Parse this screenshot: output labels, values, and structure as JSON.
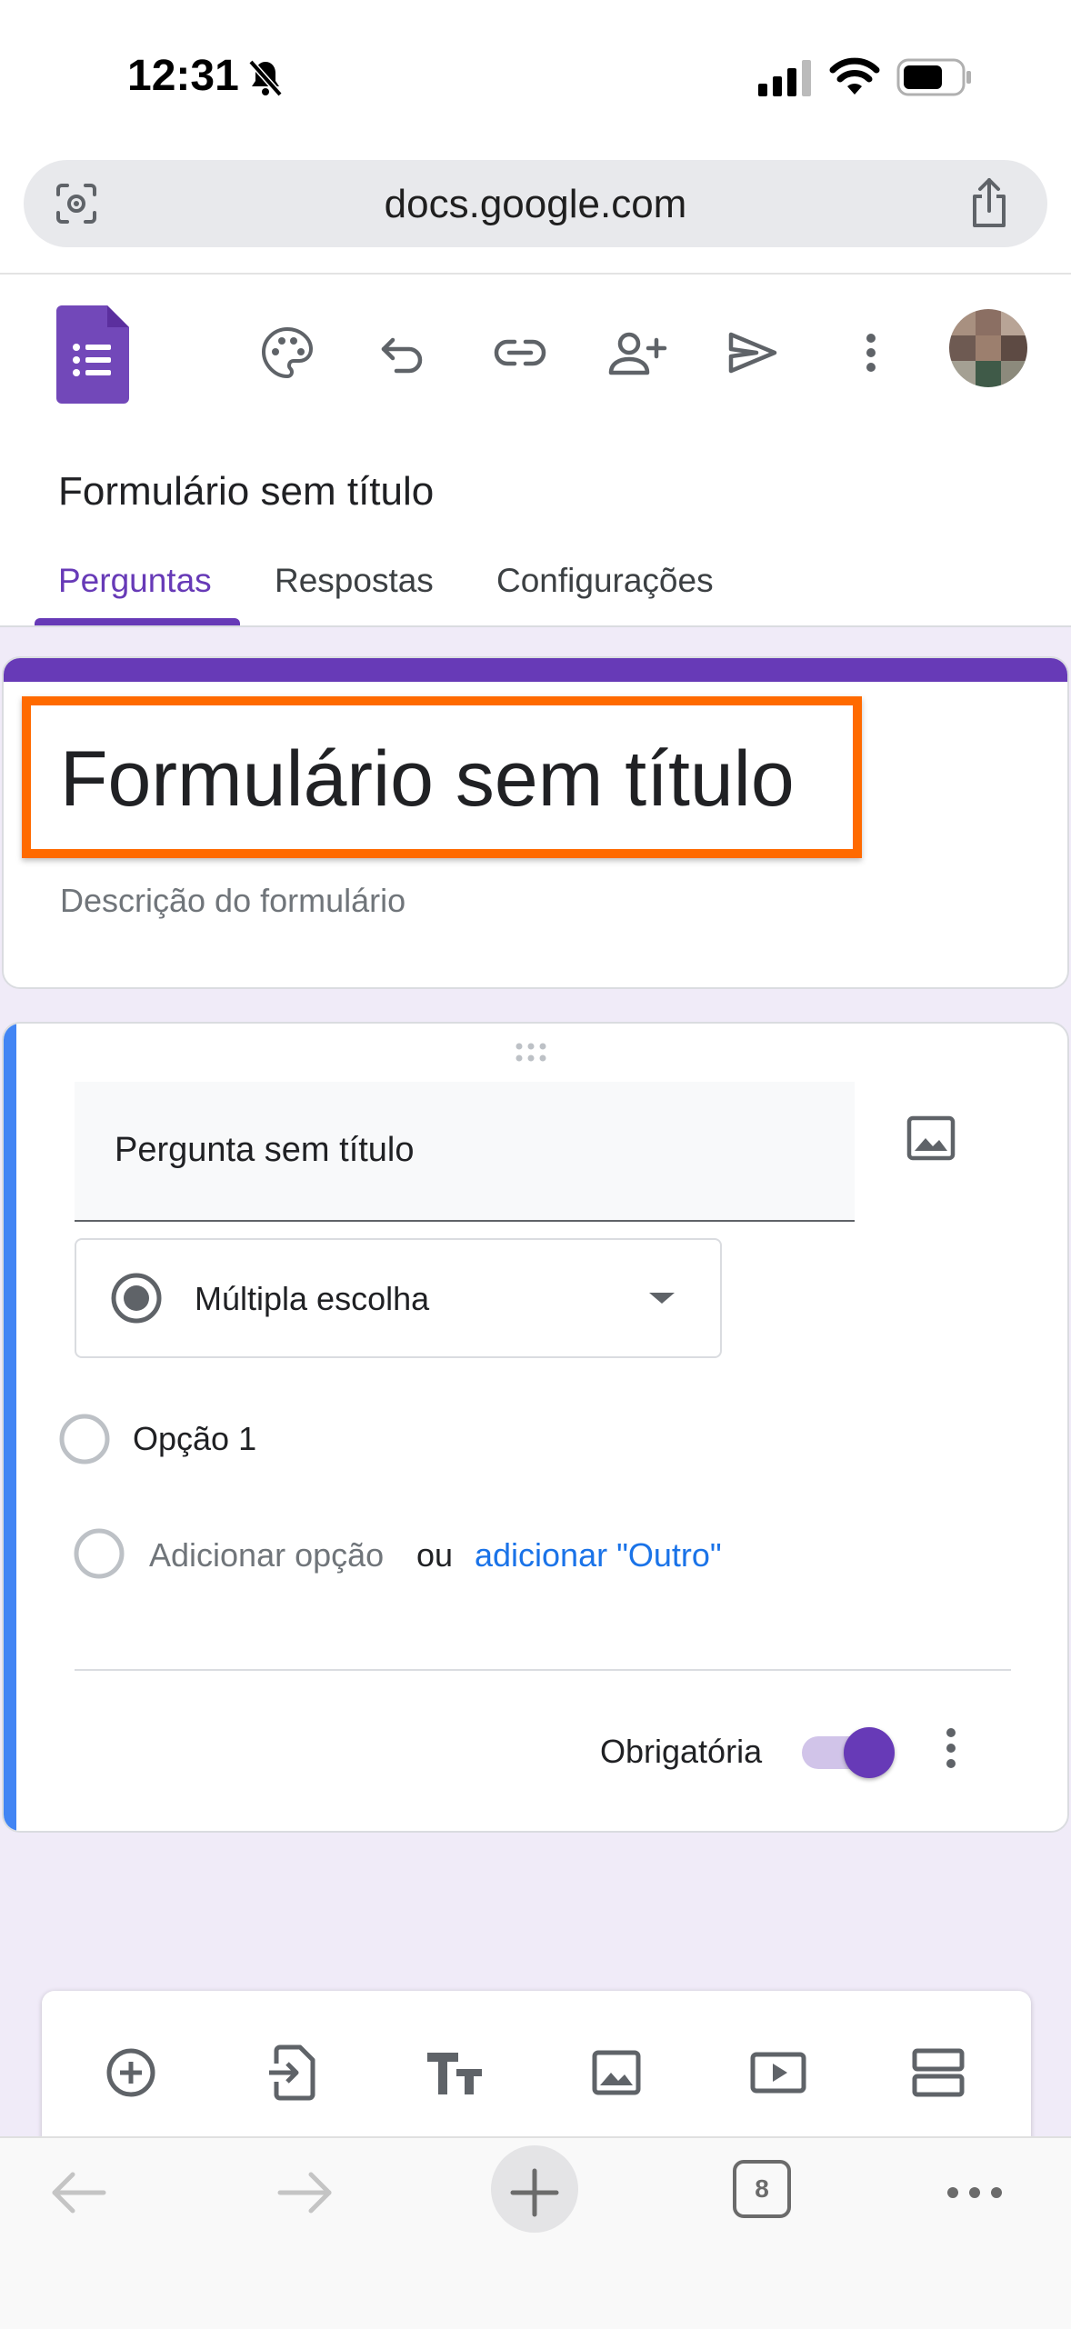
{
  "status_bar": {
    "time": "12:31"
  },
  "address_bar": {
    "url": "docs.google.com"
  },
  "toolbar": {
    "icons": [
      "palette-icon",
      "undo-icon",
      "link-icon",
      "add-collaborator-icon",
      "send-icon",
      "more-vert-icon"
    ]
  },
  "document": {
    "title": "Formulário sem título"
  },
  "tabs": [
    {
      "label": "Perguntas",
      "active": true
    },
    {
      "label": "Respostas",
      "active": false
    },
    {
      "label": "Configurações",
      "active": false
    }
  ],
  "form_header": {
    "title": "Formulário sem título",
    "description_placeholder": "Descrição do formulário"
  },
  "question": {
    "title_placeholder": "Pergunta sem título",
    "type": "Múltipla escolha",
    "options": [
      "Opção 1"
    ],
    "add_option": "Adicionar opção",
    "or": "ou",
    "add_other": "adicionar \"Outro\"",
    "required_label": "Obrigatória",
    "required": true
  },
  "bottom_toolbar": {
    "icons": [
      "add-question-icon",
      "import-questions-icon",
      "add-title-icon",
      "add-image-icon",
      "add-video-icon",
      "add-section-icon"
    ]
  },
  "browser_nav": {
    "tab_count": "8"
  },
  "colors": {
    "accent": "#673ab7",
    "highlight": "#ff6a00",
    "question_bar": "#4285f4",
    "link": "#1a73e8"
  }
}
